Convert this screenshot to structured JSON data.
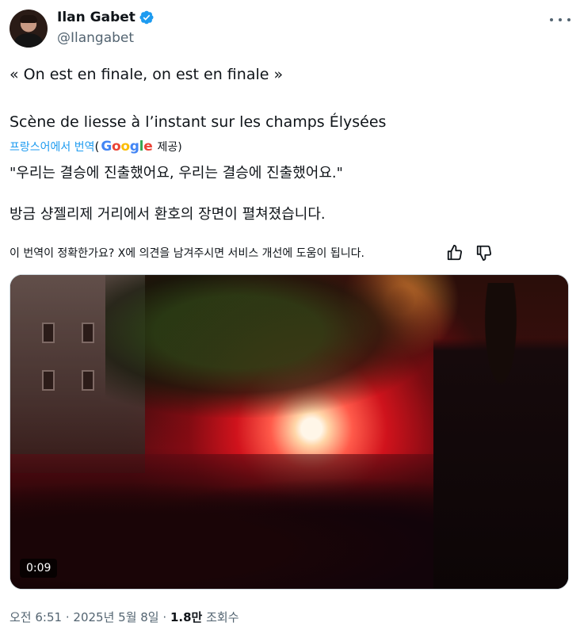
{
  "author": {
    "display_name": "Ilan Gabet",
    "handle": "@Ilangabet",
    "verified": true,
    "verified_color": "#1d9bf0"
  },
  "tweet": {
    "original_line1": "« On est en finale, on est en finale »",
    "original_line2": "Scène de liesse à l’instant sur les champs Élysées",
    "translation_link": "프랑스어에서 번역",
    "translation_provider_open": "(",
    "translation_provider_close": "제공)",
    "google_letters": [
      "G",
      "o",
      "o",
      "g",
      "l",
      "e"
    ],
    "translated_line1": "\"우리는 결승에 진출했어요, 우리는 결승에 진출했어요.\"",
    "translated_line2": "방금 샹젤리제 거리에서 환호의 장면이 펼쳐졌습니다.",
    "feedback_prompt": "이 번역이 정확한가요? X에 의견을 남겨주시면 서비스 개선에 도움이 됩니다."
  },
  "media": {
    "type": "video",
    "duration": "0:09"
  },
  "meta": {
    "time": "오전 6:51",
    "separator": "·",
    "date": "2025년 5월 8일",
    "views_count": "1.8만",
    "views_label": "조회수"
  },
  "icons": {
    "verified": "verified-badge-icon",
    "more": "more-options-icon",
    "thumbs_up": "thumbs-up-icon",
    "thumbs_down": "thumbs-down-icon"
  }
}
